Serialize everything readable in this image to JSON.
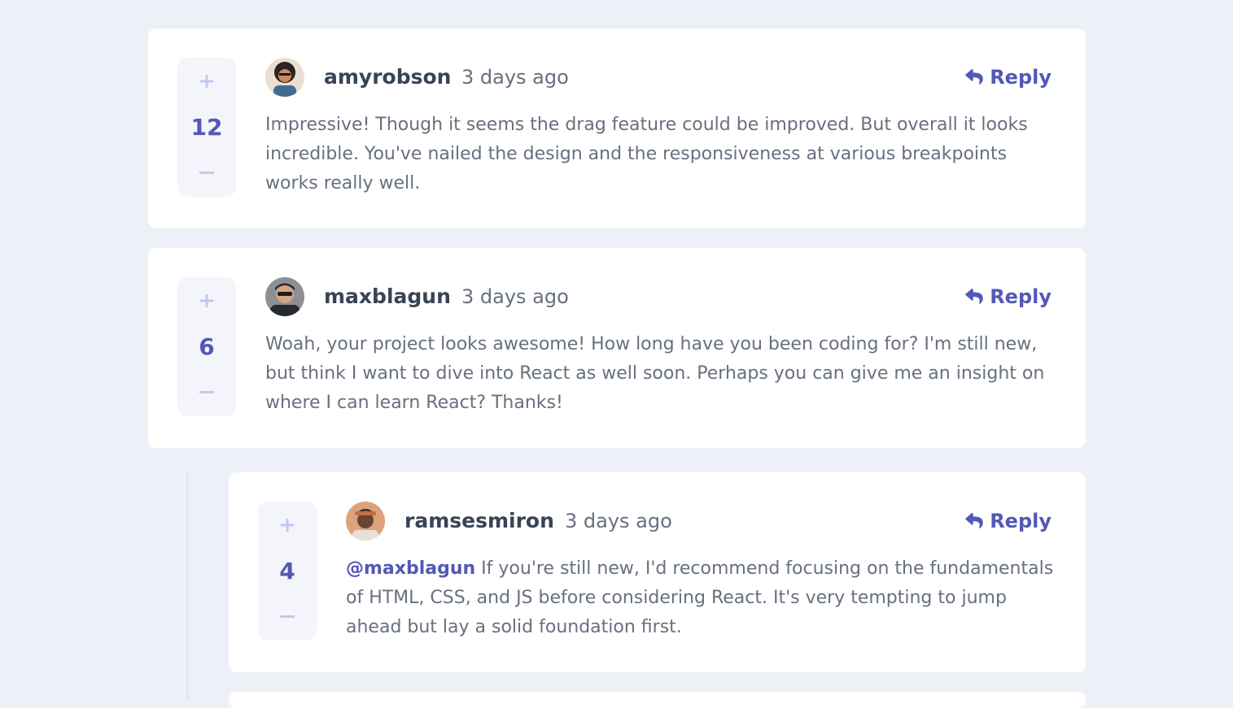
{
  "comments": [
    {
      "username": "amyrobson",
      "time": "3 days ago",
      "score": "12",
      "reply_label": "Reply",
      "content": "Impressive! Though it seems the drag feature could be improved. But overall it looks incredible. You've nailed the design and the responsiveness at various breakpoints works really well.",
      "avatar_colors": [
        "#cfa27b",
        "#3a2a23"
      ]
    },
    {
      "username": "maxblagun",
      "time": "3 days ago",
      "score": "6",
      "reply_label": "Reply",
      "content": "Woah, your project looks awesome! How long have you been coding for? I'm still new, but think I want to dive into React as well soon. Perhaps you can give me an insight on where I can learn React? Thanks!",
      "avatar_colors": [
        "#2b2f33",
        "#9aa0a6"
      ]
    },
    {
      "username": "ramsesmiron",
      "time": "3 days ago",
      "score": "4",
      "reply_label": "Reply",
      "mention": "@maxblagun",
      "content": " If you're still new, I'd recommend focusing on the fundamentals of HTML, CSS, and JS before considering React. It's very tempting to jump ahead but lay a solid foundation first.",
      "avatar_colors": [
        "#d9a37a",
        "#5a3a2a"
      ]
    }
  ],
  "icons": {
    "upvote": "plus-icon",
    "downvote": "minus-icon",
    "reply": "reply-arrow-icon"
  },
  "colors": {
    "background": "#eef0f7",
    "card": "#ffffff",
    "accent": "#5358b6",
    "vote_icon": "#c5c6ef",
    "username": "#384454",
    "body_text": "#67707f"
  }
}
